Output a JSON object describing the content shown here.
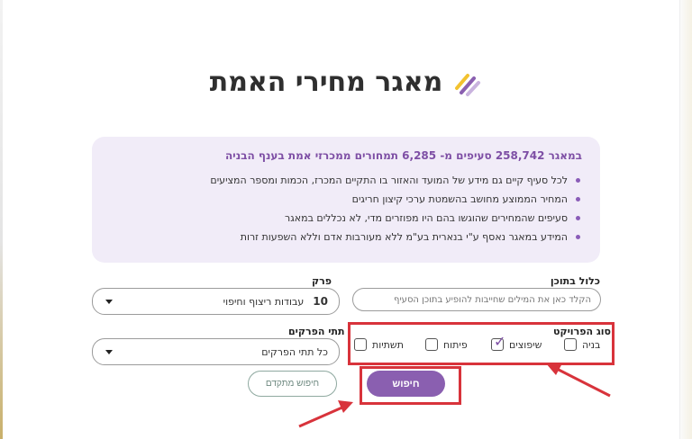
{
  "header": {
    "title": "מאגר מחירי האמת"
  },
  "info": {
    "prefix": "במאגר",
    "sections_count": "258,742",
    "middle": "סעיפים מ-",
    "price_lists_count": "6,285",
    "suffix": "תמחורים ממכרזי אמת בענף הבניה",
    "bullets": [
      "לכל סעיף קיים גם מידע של המועד והאזור בו התקיים המכרז, הכמות ומספר המציעים",
      "המחיר הממוצע מחושב בהשמטת ערכי קיצון חריגים",
      "סעיפים שהמחירים שהוגשו בהם היו מפוזרים מדי, לא נכללים במאגר",
      "המידע במאגר נאסף ע\"י בנארית בע\"מ ללא מעורבות אדם וללא השפעות זרות"
    ]
  },
  "filters": {
    "content_label": "כלול בתוכן",
    "content_placeholder": "הקלד כאן את המילים שחייבות להופיע בתוכן הסעיף",
    "chapter_label": "פרק",
    "chapter_number": "10",
    "chapter_name": "עבודות ריצוף וחיפוי",
    "subchapter_label": "תתי הפרקים",
    "subchapter_value": "כל תתי הפרקים",
    "project_type_label": "סוג הפרויקט",
    "project_types": [
      {
        "label": "בניה",
        "checked": false
      },
      {
        "label": "שיפוצים",
        "checked": true
      },
      {
        "label": "פיתוח",
        "checked": false
      },
      {
        "label": "תשתיות",
        "checked": false
      }
    ]
  },
  "actions": {
    "search_label": "חיפוש",
    "advanced_label": "חיפוש מתקדם"
  },
  "colors": {
    "brand_purple": "#8a5fb0",
    "info_bg": "#f1ecf8",
    "annotation_red": "#d8333b"
  }
}
